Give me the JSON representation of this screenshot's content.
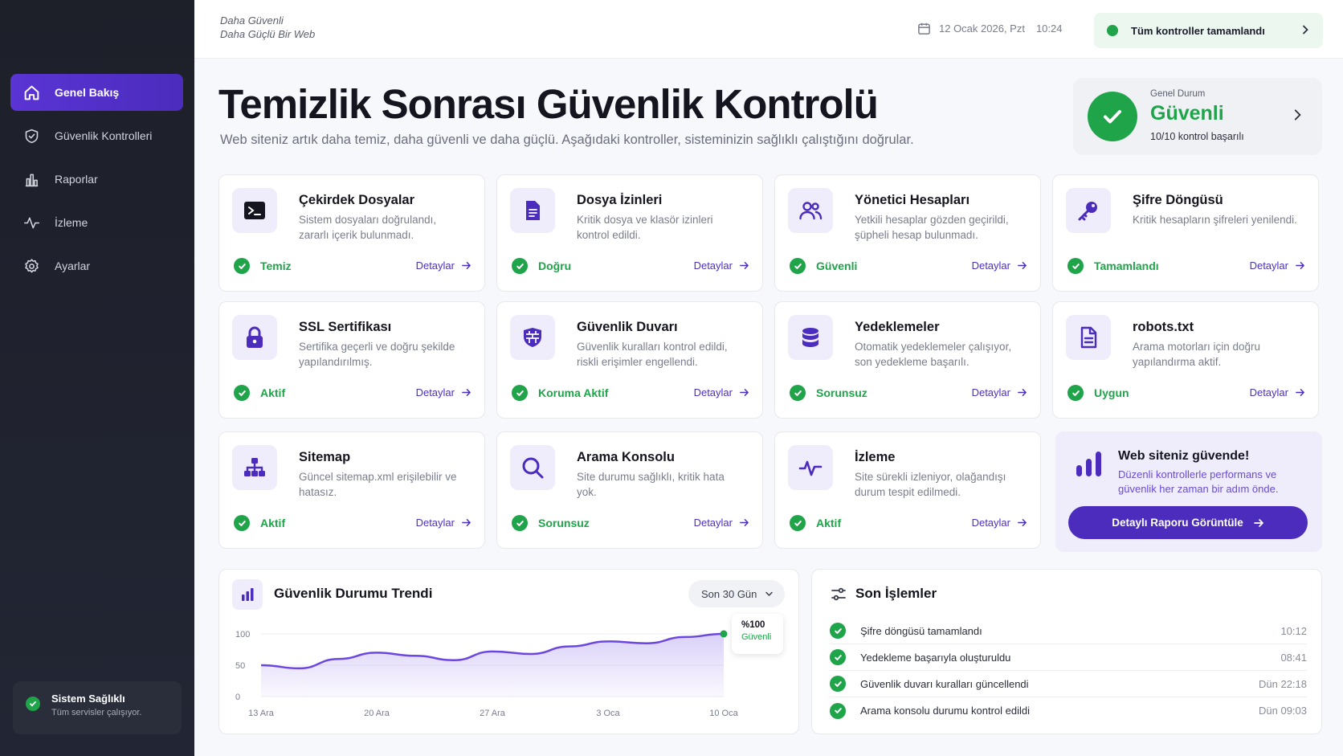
{
  "sidebar": {
    "items": [
      {
        "label": "Genel Bakış",
        "icon": "home-icon",
        "active": true
      },
      {
        "label": "Güvenlik Kontrolleri",
        "icon": "shield-icon",
        "active": false
      },
      {
        "label": "Raporlar",
        "icon": "bar-chart-icon",
        "active": false
      },
      {
        "label": "İzleme",
        "icon": "pulse-icon",
        "active": false
      },
      {
        "label": "Ayarlar",
        "icon": "gear-icon",
        "active": false
      }
    ],
    "health": {
      "title": "Sistem Sağlıklı",
      "subtitle": "Tüm servisler çalışıyor."
    }
  },
  "header": {
    "brand_line1": "Daha Güvenli",
    "brand_line2": "Daha Güçlü Bir Web",
    "date": "12 Ocak 2026, Pzt",
    "time": "10:24",
    "status_pill": "Tüm kontroller tamamlandı"
  },
  "main": {
    "title": "Temizlik Sonrası Güvenlik Kontrolü",
    "subtitle": "Web siteniz artık daha temiz, daha güvenli ve daha güçlü. Aşağıdaki kontroller, sisteminizin sağlıklı çalıştığını doğrular.",
    "overall": {
      "label": "Genel Durum",
      "value": "Güvenli",
      "count": "10/10 kontrol başarılı"
    },
    "details_label": "Detaylar",
    "cards": [
      {
        "title": "Çekirdek Dosyalar",
        "desc": "Sistem dosyaları doğrulandı, zararlı içerik bulunmadı.",
        "status": "Temiz",
        "icon": "terminal-icon"
      },
      {
        "title": "Dosya İzinleri",
        "desc": "Kritik dosya ve klasör izinleri kontrol edildi.",
        "status": "Doğru",
        "icon": "document-icon"
      },
      {
        "title": "Yönetici Hesapları",
        "desc": "Yetkili hesaplar gözden geçirildi, şüpheli hesap bulunmadı.",
        "status": "Güvenli",
        "icon": "users-icon"
      },
      {
        "title": "Şifre Döngüsü",
        "desc": "Kritik hesapların şifreleri yenilendi.",
        "status": "Tamamlandı",
        "icon": "key-icon"
      },
      {
        "title": "SSL Sertifikası",
        "desc": "Sertifika geçerli ve doğru şekilde yapılandırılmış.",
        "status": "Aktif",
        "icon": "lock-icon"
      },
      {
        "title": "Güvenlik Duvarı",
        "desc": "Güvenlik kuralları kontrol edildi, riskli erişimler engellendi.",
        "status": "Koruma Aktif",
        "icon": "firewall-icon"
      },
      {
        "title": "Yedeklemeler",
        "desc": "Otomatik yedeklemeler çalışıyor, son yedekleme başarılı.",
        "status": "Sorunsuz",
        "icon": "database-icon"
      },
      {
        "title": "robots.txt",
        "desc": "Arama motorları için doğru yapılandırma aktif.",
        "status": "Uygun",
        "icon": "file-text-icon"
      },
      {
        "title": "Sitemap",
        "desc": "Güncel sitemap.xml erişilebilir ve hatasız.",
        "status": "Aktif",
        "icon": "sitemap-icon"
      },
      {
        "title": "Arama Konsolu",
        "desc": "Site durumu sağlıklı, kritik hata yok.",
        "status": "Sorunsuz",
        "icon": "search-icon"
      },
      {
        "title": "İzleme",
        "desc": "Site sürekli izleniyor, olağandışı durum tespit edilmedi.",
        "status": "Aktif",
        "icon": "pulse-icon"
      }
    ],
    "promo": {
      "title": "Web siteniz güvende!",
      "desc": "Düzenli kontrollerle performans ve güvenlik her zaman bir adım önde.",
      "button": "Detaylı Raporu Görüntüle"
    }
  },
  "trend": {
    "title": "Güvenlik Durumu Trendi",
    "range": "Son 30 Gün",
    "tooltip_value": "%100",
    "tooltip_label": "Güvenli"
  },
  "chart_data": {
    "type": "area",
    "title": "Güvenlik Durumu Trendi",
    "x_ticks": [
      "13 Ara",
      "20 Ara",
      "27 Ara",
      "3 Oca",
      "10 Oca"
    ],
    "y_ticks": [
      "100",
      "50",
      "0"
    ],
    "ylim": [
      0,
      100
    ],
    "x": [
      "13 Ara",
      "15 Ara",
      "18 Ara",
      "20 Ara",
      "23 Ara",
      "25 Ara",
      "27 Ara",
      "30 Ara",
      "1 Oca",
      "3 Oca",
      "6 Oca",
      "8 Oca",
      "10 Oca"
    ],
    "values": [
      50,
      45,
      60,
      70,
      65,
      58,
      72,
      68,
      80,
      88,
      85,
      95,
      100
    ],
    "grid": true,
    "accent": "#6b46e0"
  },
  "recent": {
    "title": "Son İşlemler",
    "items": [
      {
        "text": "Şifre döngüsü tamamlandı",
        "time": "10:12"
      },
      {
        "text": "Yedekleme başarıyla oluşturuldu",
        "time": "08:41"
      },
      {
        "text": "Güvenlik duvarı kuralları güncellendi",
        "time": "Dün 22:18"
      },
      {
        "text": "Arama konsolu durumu kontrol edildi",
        "time": "Dün 09:03"
      }
    ]
  },
  "colors": {
    "accent": "#4b2cbd",
    "success": "#1fa44a",
    "sidebar": "#1d1f29"
  }
}
